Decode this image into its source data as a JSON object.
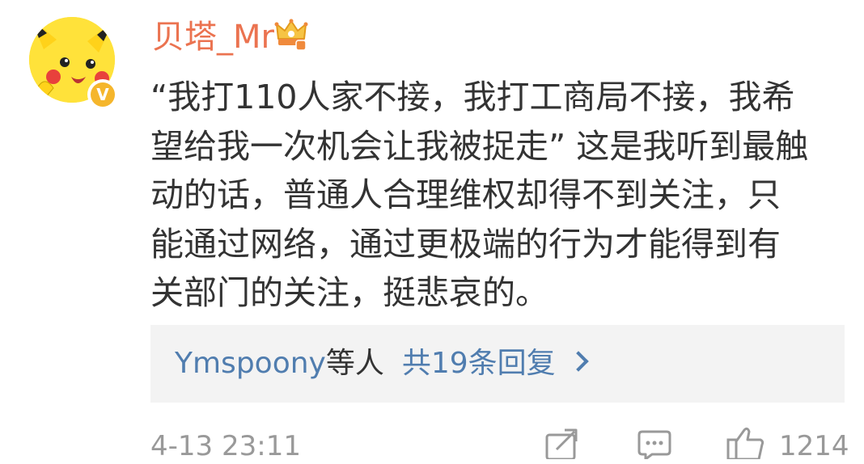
{
  "comment": {
    "username": "贝塔_Mr",
    "content_lines": [
      "“我打110人家不接，我打工商局不接，我希",
      "望给我一次机会让我被捉走” 这是我听到最触",
      "动的话，普通人合理维权却得不到关注，只",
      "能通过网络，通过更极端的行为才能得到有",
      "关部门的关注，挺悲哀的。"
    ],
    "verified_badge": "V",
    "replies": {
      "users": "Ymspoony",
      "suffix": "等人",
      "link": "共19条回复"
    },
    "timestamp": "4-13 23:11",
    "like_count": "1214"
  },
  "icons": {
    "crown": "crown-icon",
    "share": "share-icon",
    "comment": "comment-icon",
    "like": "thumbs-up-icon",
    "chevron": "chevron-right-icon"
  },
  "colors": {
    "username": "#eb7350",
    "link": "#507daf",
    "text": "#333333",
    "meta": "#999999",
    "reply_bg": "#f3f3f3",
    "avatar_bg": "#ffe23a",
    "badge": "#f5b62c"
  }
}
